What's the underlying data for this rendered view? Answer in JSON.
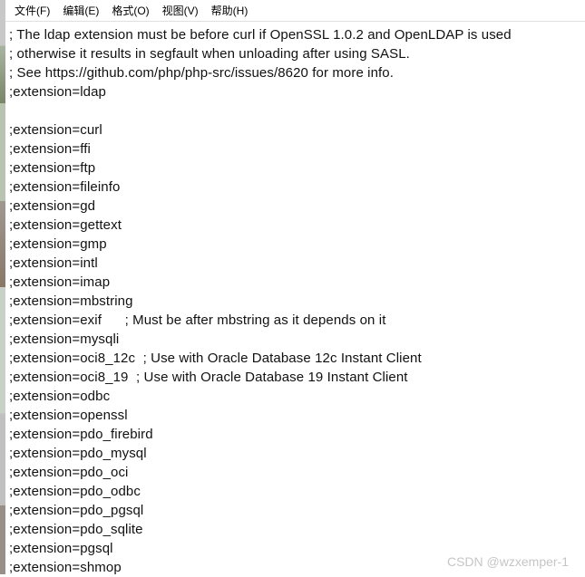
{
  "menubar": {
    "items": [
      "文件(F)",
      "编辑(E)",
      "格式(O)",
      "视图(V)",
      "帮助(H)"
    ]
  },
  "editor": {
    "lines": [
      "; The ldap extension must be before curl if OpenSSL 1.0.2 and OpenLDAP is used",
      "; otherwise it results in segfault when unloading after using SASL.",
      "; See https://github.com/php/php-src/issues/8620 for more info.",
      ";extension=ldap",
      "",
      ";extension=curl",
      ";extension=ffi",
      ";extension=ftp",
      ";extension=fileinfo",
      ";extension=gd",
      ";extension=gettext",
      ";extension=gmp",
      ";extension=intl",
      ";extension=imap",
      ";extension=mbstring",
      ";extension=exif      ; Must be after mbstring as it depends on it",
      ";extension=mysqli",
      ";extension=oci8_12c  ; Use with Oracle Database 12c Instant Client",
      ";extension=oci8_19  ; Use with Oracle Database 19 Instant Client",
      ";extension=odbc",
      ";extension=openssl",
      ";extension=pdo_firebird",
      ";extension=pdo_mysql",
      ";extension=pdo_oci",
      ";extension=pdo_odbc",
      ";extension=pdo_pgsql",
      ";extension=pdo_sqlite",
      ";extension=pgsql",
      ";extension=shmop"
    ]
  },
  "watermark": "CSDN @wzxemper-1"
}
